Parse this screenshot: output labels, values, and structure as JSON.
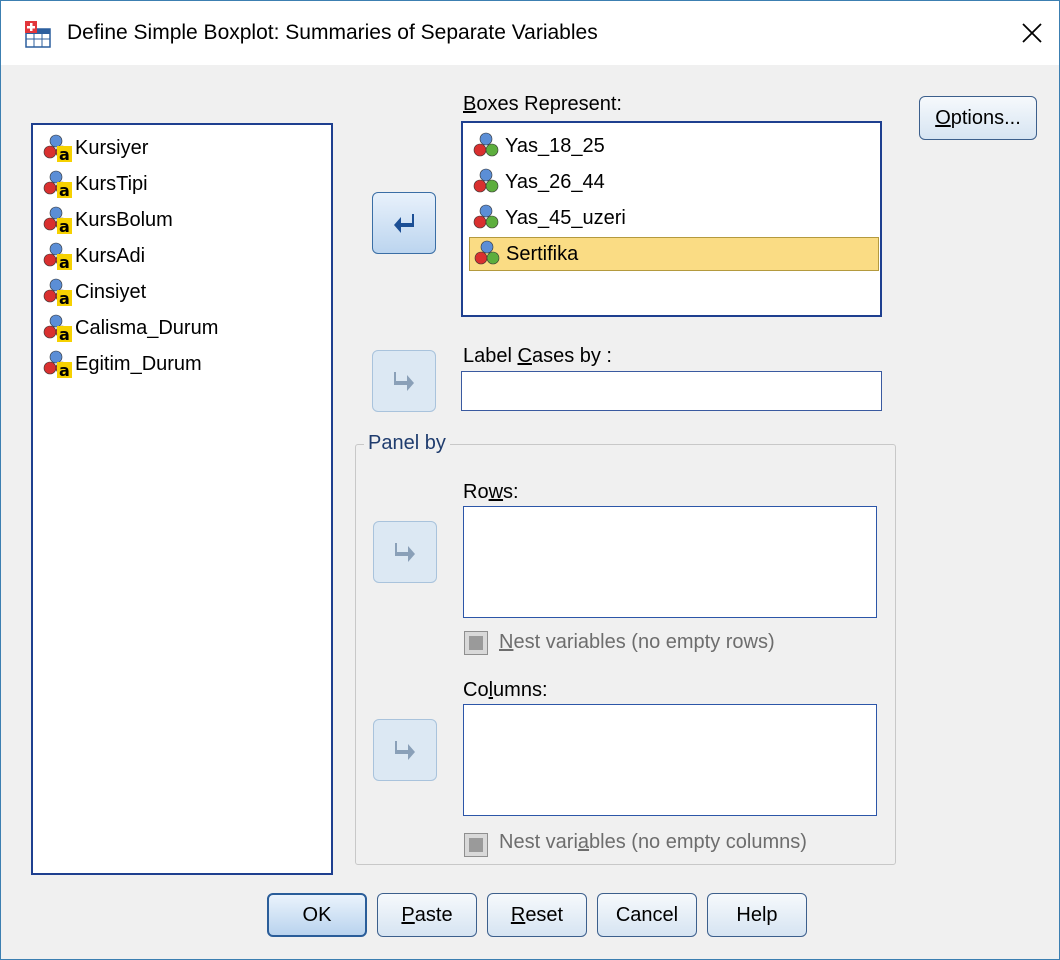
{
  "window": {
    "title": "Define Simple Boxplot: Summaries of Separate Variables",
    "app_icon": "chart-builder-icon",
    "close_icon": "close-icon"
  },
  "source_list": {
    "items": [
      {
        "label": "Kursiyer",
        "icon": "nominal-string-variable-icon"
      },
      {
        "label": "KursTipi",
        "icon": "nominal-string-variable-icon"
      },
      {
        "label": "KursBolum",
        "icon": "nominal-string-variable-icon"
      },
      {
        "label": "KursAdi",
        "icon": "nominal-string-variable-icon"
      },
      {
        "label": "Cinsiyet",
        "icon": "nominal-string-variable-icon"
      },
      {
        "label": "Calisma_Durum",
        "icon": "nominal-string-variable-icon"
      },
      {
        "label": "Egitim_Durum",
        "icon": "nominal-string-variable-icon"
      }
    ]
  },
  "boxes_represent": {
    "label_pre": "",
    "label_key": "B",
    "label_post": "oxes Represent:",
    "items": [
      {
        "label": "Yas_18_25",
        "icon": "nominal-variable-icon"
      },
      {
        "label": "Yas_26_44",
        "icon": "nominal-variable-icon"
      },
      {
        "label": "Yas_45_uzeri",
        "icon": "nominal-variable-icon"
      },
      {
        "label": "Sertifika",
        "icon": "nominal-variable-icon",
        "selected": true
      }
    ]
  },
  "label_cases": {
    "label_pre": "Label ",
    "label_key": "C",
    "label_post": "ases by :",
    "value": ""
  },
  "panel_by": {
    "legend": "Panel by",
    "rows": {
      "label_pre": "Ro",
      "label_key": "w",
      "label_post": "s:",
      "nest_pre": "",
      "nest_key": "N",
      "nest_post": "est variables (no empty rows)"
    },
    "columns": {
      "label_pre": "Co",
      "label_key": "l",
      "label_post": "umns:",
      "nest_pre": "Nest vari",
      "nest_key": "a",
      "nest_post": "bles (no empty columns)"
    }
  },
  "buttons": {
    "options": {
      "pre": "",
      "key": "O",
      "post": "ptions..."
    },
    "ok": "OK",
    "paste": {
      "pre": "",
      "key": "P",
      "post": "aste"
    },
    "reset": {
      "pre": "",
      "key": "R",
      "post": "eset"
    },
    "cancel": "Cancel",
    "help": "Help"
  }
}
